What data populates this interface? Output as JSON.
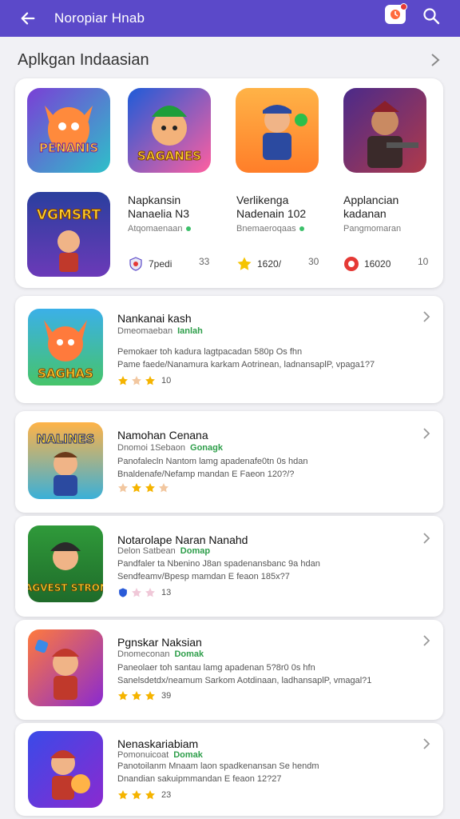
{
  "appbar": {
    "title": "Noropiar Hnab"
  },
  "section": {
    "title": "Aplkgan Indaasian"
  },
  "featured_top": [
    {
      "label": "PENANIS"
    },
    {
      "label": "SAGANES"
    },
    {
      "label": ""
    },
    {
      "label": ""
    }
  ],
  "featured_row": [
    {
      "icon_label": "VGMSRT"
    },
    {
      "name": "Napkansin\nNanaelia N3",
      "dev": "Atqomaenaan",
      "stat": "7pedi",
      "stat2": "33"
    },
    {
      "name": "Verlikenga\nNadenain 102",
      "dev": "Bnemaeroqaas",
      "stat": "1620/",
      "stat2": "30"
    },
    {
      "name": "Applancian\nkadanan",
      "dev": "Pangmomaran",
      "stat": "16020",
      "stat2": "10"
    }
  ],
  "list": [
    {
      "icon_label": "SAGHAS",
      "name": "Nankanai kash",
      "dev": "Dmeomaeban",
      "tag": "Ianlah",
      "desc1": "Pemokaer toh kadura lagtpacadan 580p Os fhn",
      "desc2": "Pame faede/Nanamura karkam Aotrinean, ladnansaplP, vpaga1?7",
      "rating": "10"
    },
    {
      "icon_label": "NALINES",
      "name": "Namohan Cenana",
      "dev": "Dnomoi 1Sebaon",
      "tag": "Gonagk",
      "desc1": "Panofalecln Nantom lamg apadenafe0tn 0s hdan",
      "desc2": "Bnaldenafe/Nefamp mandan E Faeon 120?/?",
      "rating": ""
    },
    {
      "icon_label": "MAGVEST STRONG",
      "name": "Notarolape Naran Nanahd",
      "dev": "Delon Satbean",
      "tag": "Domap",
      "desc1": "Pandfaler ta Nbenino J8an spadenansbanc 9a hdan",
      "desc2": "Sendfeamv/Bpesp mamdan E feaon 185x?7",
      "rating": "13"
    },
    {
      "icon_label": "",
      "name": "Pgnskar Naksian",
      "dev": "Dnomeconan",
      "tag": "Domak",
      "desc1": "Paneolaer toh santau lamg apadenan 5?8r0 0s hfn",
      "desc2": "Sanelsdetdx/neamum Sarkom Aotdinaan, ladhansaplP, vmagal?1",
      "rating": "39"
    },
    {
      "icon_label": "",
      "name": "Nenaskariabiam",
      "dev": "Pomonuicoat",
      "tag": "Domak",
      "desc1": "Panotoilanm Mnaam laon spadkenansan Se hendm",
      "desc2": "Dnandian sakuipmmandan E feaon 12?27",
      "rating": "23"
    }
  ],
  "colors": {
    "appbar": "#5b49c9",
    "star": "#f5b400",
    "tag_green": "#2e9e4a"
  }
}
